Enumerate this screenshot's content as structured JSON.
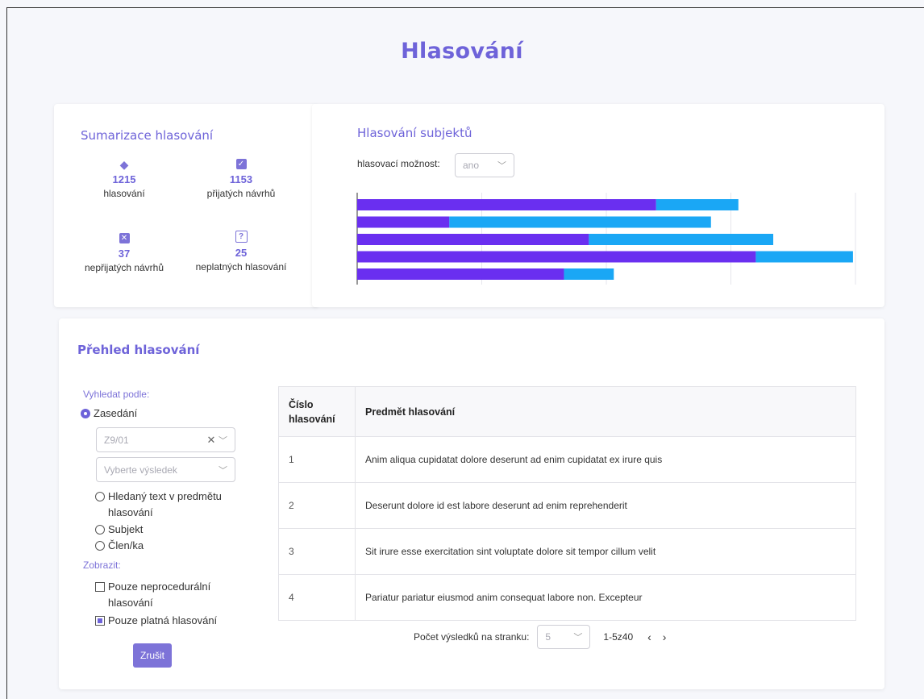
{
  "page": {
    "title": "Hlasování"
  },
  "summary": {
    "title": "Sumarizace hlasování",
    "stats": [
      {
        "icon": "layers-icon",
        "value": "1215",
        "label": "hlasování"
      },
      {
        "icon": "check-square-icon",
        "value": "1153",
        "label": "přijatých návrhů"
      },
      {
        "icon": "x-square-icon",
        "value": "37",
        "label": "nepřijatých návrhů"
      },
      {
        "icon": "question-square-icon",
        "value": "25",
        "label": "neplatných hlasování"
      }
    ]
  },
  "subjects": {
    "title": "Hlasování subjektů",
    "option_label": "hlasovací možnost:",
    "option_value": "ano"
  },
  "chart_data": {
    "type": "bar",
    "orientation": "horizontal",
    "stacked": true,
    "colors": [
      "#6a2ff0",
      "#1aa7f5"
    ],
    "series": [
      {
        "values": [
          120,
          37,
          93,
          160,
          83
        ]
      },
      {
        "values": [
          33,
          105,
          74,
          39,
          20
        ]
      }
    ],
    "xlim": [
      0,
      200
    ],
    "grid": true
  },
  "overview": {
    "title": "Přehled hlasování",
    "search_by_label": "Vyhledat podle:",
    "radio_session": "Zasedání",
    "session_value": "Z9/01",
    "result_placeholder": "Vyberte výsledek",
    "radio_text_line1": "Hledaný text v predmětu",
    "radio_text_line2": "hlasování",
    "radio_subject": "Subjekt",
    "radio_member": "Člen/ka",
    "show_label": "Zobrazit:",
    "check_nonproc_line1": "Pouze neprocedurální",
    "check_nonproc_line2": "hlasování",
    "check_valid": "Pouze platná hlasování",
    "cancel_button": "Zrušit",
    "table": {
      "col_number_line1": "Číslo",
      "col_number_line2": "hlasování",
      "col_subject": "Predmět hlasování",
      "rows": [
        {
          "num": "1",
          "subject": "Anim aliqua cupidatat dolore deserunt ad enim cupidatat ex irure quis"
        },
        {
          "num": "2",
          "subject": "Deserunt dolore id est labore deserunt ad enim reprehenderit"
        },
        {
          "num": "3",
          "subject": "Sit irure esse exercitation sint voluptate dolore sit tempor cillum velit"
        },
        {
          "num": "4",
          "subject": "Pariatur pariatur eiusmod anim consequat labore non. Excepteur"
        }
      ]
    },
    "pager": {
      "per_page_label": "Počet výsledků na stranku:",
      "per_page_value": "5",
      "range": "1-5z40",
      "prev": "‹",
      "next": "›"
    }
  }
}
